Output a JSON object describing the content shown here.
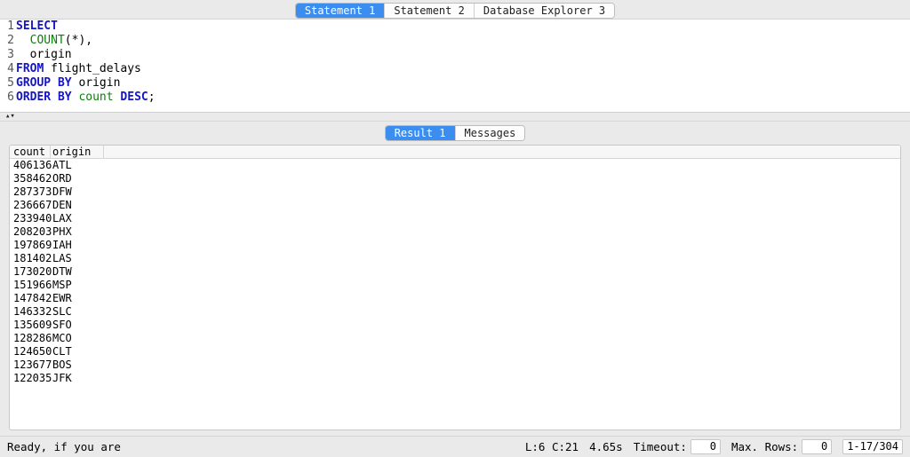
{
  "top_tabs": {
    "items": [
      {
        "label": "Statement 1",
        "active": true
      },
      {
        "label": "Statement 2",
        "active": false
      },
      {
        "label": "Database Explorer 3",
        "active": false
      }
    ]
  },
  "editor": {
    "lines": [
      {
        "no": "1",
        "tokens": [
          {
            "t": "SELECT",
            "c": "kw"
          }
        ]
      },
      {
        "no": "2",
        "tokens": [
          {
            "t": "  ",
            "c": "sym"
          },
          {
            "t": "COUNT",
            "c": "ident"
          },
          {
            "t": "(*),",
            "c": "sym"
          }
        ]
      },
      {
        "no": "3",
        "tokens": [
          {
            "t": "  origin",
            "c": "sym"
          }
        ]
      },
      {
        "no": "4",
        "tokens": [
          {
            "t": "FROM",
            "c": "kw"
          },
          {
            "t": " flight_delays",
            "c": "sym"
          }
        ]
      },
      {
        "no": "5",
        "tokens": [
          {
            "t": "GROUP BY",
            "c": "kw"
          },
          {
            "t": " origin",
            "c": "sym"
          }
        ]
      },
      {
        "no": "6",
        "tokens": [
          {
            "t": "ORDER BY",
            "c": "kw"
          },
          {
            "t": " ",
            "c": "sym"
          },
          {
            "t": "count",
            "c": "ident"
          },
          {
            "t": " ",
            "c": "sym"
          },
          {
            "t": "DESC",
            "c": "kw"
          },
          {
            "t": ";",
            "c": "sym"
          }
        ]
      }
    ]
  },
  "splitter_glyph": "▴▾",
  "result_tabs": {
    "items": [
      {
        "label": "Result 1",
        "active": true
      },
      {
        "label": "Messages",
        "active": false
      }
    ]
  },
  "grid": {
    "columns": [
      "count",
      "origin"
    ],
    "rows": [
      {
        "count": "406136",
        "origin": "ATL"
      },
      {
        "count": "358462",
        "origin": "ORD"
      },
      {
        "count": "287373",
        "origin": "DFW"
      },
      {
        "count": "236667",
        "origin": "DEN"
      },
      {
        "count": "233940",
        "origin": "LAX"
      },
      {
        "count": "208203",
        "origin": "PHX"
      },
      {
        "count": "197869",
        "origin": "IAH"
      },
      {
        "count": "181402",
        "origin": "LAS"
      },
      {
        "count": "173020",
        "origin": "DTW"
      },
      {
        "count": "151966",
        "origin": "MSP"
      },
      {
        "count": "147842",
        "origin": "EWR"
      },
      {
        "count": "146332",
        "origin": "SLC"
      },
      {
        "count": "135609",
        "origin": "SFO"
      },
      {
        "count": "128286",
        "origin": "MCO"
      },
      {
        "count": "124650",
        "origin": "CLT"
      },
      {
        "count": "123677",
        "origin": "BOS"
      },
      {
        "count": "122035",
        "origin": "JFK"
      }
    ]
  },
  "status": {
    "message": "Ready, if you are",
    "cursor": "L:6 C:21",
    "elapsed": "4.65s",
    "timeout_label": "Timeout:",
    "timeout_value": "0",
    "maxrows_label": "Max. Rows:",
    "maxrows_value": "0",
    "range": "1-17/304"
  }
}
